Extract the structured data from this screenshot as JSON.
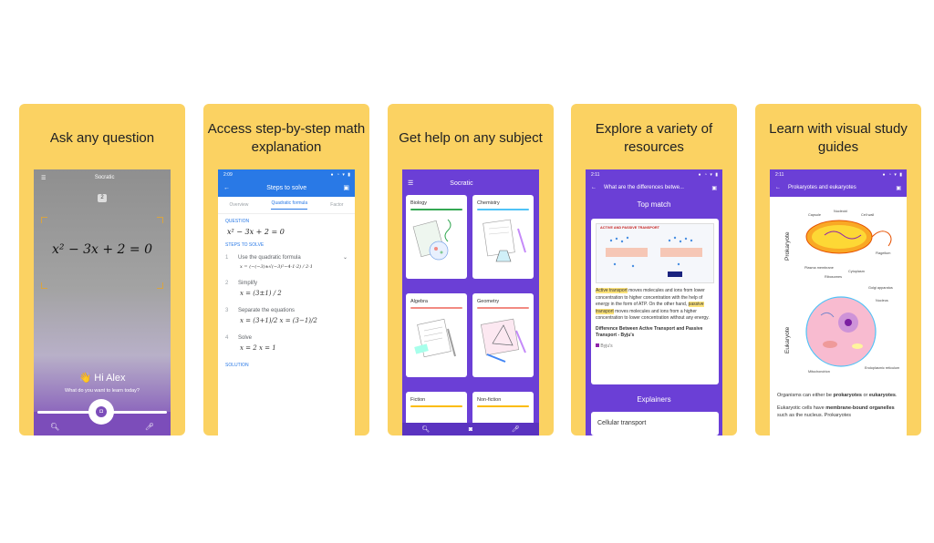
{
  "cards": [
    {
      "caption": "Ask any question",
      "app_name": "Socratic",
      "equation": "x² − 3x + 2 = 0",
      "greeting": "👋 Hi Alex",
      "greeting_sub": "What do you want to learn today?"
    },
    {
      "caption": "Access step-by-step math explanation",
      "status_time": "2:09",
      "title": "Steps to solve",
      "tabs": [
        "Overview",
        "Quadratic formula",
        "Factor"
      ],
      "question_label": "QUESTION",
      "question": "x² − 3x + 2 = 0",
      "steps_label": "STEPS TO SOLVE",
      "steps": [
        {
          "num": "1",
          "label": "Use the quadratic formula",
          "math": "x = (−(−3)±√(−3)²−4·1·2) / 2·1"
        },
        {
          "num": "2",
          "label": "Simplify",
          "math": "x = (3±1) / 2"
        },
        {
          "num": "3",
          "label": "Separate the equations",
          "math": "x = (3+1)/2   x = (3−1)/2"
        },
        {
          "num": "4",
          "label": "Solve",
          "math": "x = 2   x = 1"
        }
      ],
      "solution_label": "SOLUTION"
    },
    {
      "caption": "Get help on any subject",
      "app_name": "Socratic",
      "subjects": [
        "Biology",
        "Chemistry",
        "Algebra",
        "Geometry",
        "Fiction",
        "Non-fiction"
      ]
    },
    {
      "caption": "Explore a variety of resources",
      "status_time": "2:11",
      "title": "What are the differences betwe...",
      "top_match": "Top match",
      "figure_title": "ACTIVE AND PASSIVE TRANSPORT",
      "result_text_1": "Active transport",
      "result_text_2": " moves molecules and ions from lower concentration to higher concentration with the help of energy in the form of ATP. On the other hand, ",
      "result_text_3": "passive transport",
      "result_text_4": " moves molecules and ions from a higher concentration to lower concentration without any energy.",
      "result_heading": "Difference Between Active Transport and Passive Transport - Byju's",
      "source": "Byju's",
      "explainers": "Explainers",
      "explainer_item": "Cellular transport"
    },
    {
      "caption": "Learn with visual study guides",
      "status_time": "2:11",
      "title": "Prokaryotes and eukaryotes",
      "label_prokaryote": "Prokaryote",
      "label_eukaryote": "Eukaryote",
      "prokaryote_tags": [
        "Capsule",
        "Nucleoid",
        "Cell wall",
        "Flagellum",
        "Plasma membrane",
        "Ribosomes",
        "Cytoplasm"
      ],
      "eukaryote_tags": [
        "Golgi apparatus",
        "Nucleus",
        "Mitochondrion",
        "Endoplasmic reticulum"
      ],
      "para1_a": "Organisms can either be ",
      "para1_b": "prokaryotes",
      "para1_c": " or ",
      "para1_d": "eukaryotes",
      "para1_e": ".",
      "para2_a": "Eukaryotic cells have ",
      "para2_b": "membrane-bound organelles",
      "para2_c": " such as the nucleus. Prokaryotes"
    }
  ]
}
